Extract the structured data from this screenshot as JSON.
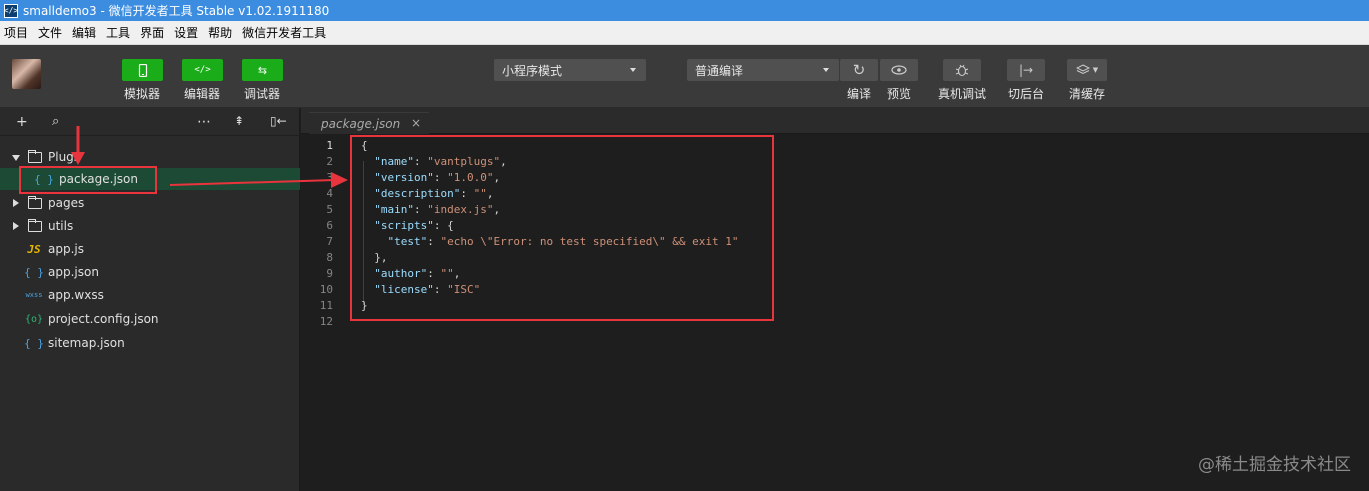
{
  "window": {
    "title": "smalldemo3 - 微信开发者工具 Stable v1.02.1911180",
    "app_icon": "</>"
  },
  "menu": [
    "项目",
    "文件",
    "编辑",
    "工具",
    "界面",
    "设置",
    "帮助",
    "微信开发者工具"
  ],
  "toolbar": {
    "simulator_label": "模拟器",
    "editor_label": "编辑器",
    "debugger_label": "调试器",
    "mode_select": "小程序模式",
    "compile_select": "普通编译",
    "compile_label": "编译",
    "preview_label": "预览",
    "device_debug_label": "真机调试",
    "background_label": "切后台",
    "clear_cache_label": "清缓存",
    "icons": {
      "simulator": "phone-icon",
      "editor": "code-icon",
      "debugger": "swap-icon",
      "compile": "refresh-icon",
      "preview": "eye-icon",
      "device_debug": "bug-icon",
      "background": "exit-icon",
      "clear_cache": "layers-icon"
    }
  },
  "sidebar": {
    "tree": [
      {
        "label": "Plugs",
        "type": "folder",
        "expanded": true
      },
      {
        "label": "package.json",
        "type": "json",
        "icon": "{ }"
      },
      {
        "label": "pages",
        "type": "folder",
        "expanded": false
      },
      {
        "label": "utils",
        "type": "folder",
        "expanded": false
      },
      {
        "label": "app.js",
        "type": "js",
        "icon": "JS"
      },
      {
        "label": "app.json",
        "type": "json",
        "icon": "{ }"
      },
      {
        "label": "app.wxss",
        "type": "wxss",
        "icon": "wxss"
      },
      {
        "label": "project.config.json",
        "type": "config",
        "icon": "{o}"
      },
      {
        "label": "sitemap.json",
        "type": "json",
        "icon": "{ }"
      }
    ]
  },
  "editor": {
    "tab_label": "package.json",
    "line_numbers": [
      "1",
      "2",
      "3",
      "4",
      "5",
      "6",
      "7",
      "8",
      "9",
      "10",
      "11",
      "12"
    ],
    "code": {
      "l1": "{",
      "name_key": "\"name\"",
      "name_val": "\"vantplugs\"",
      "version_key": "\"version\"",
      "version_val": "\"1.0.0\"",
      "description_key": "\"description\"",
      "description_val": "\"\"",
      "main_key": "\"main\"",
      "main_val": "\"index.js\"",
      "scripts_key": "\"scripts\"",
      "test_key": "\"test\"",
      "test_val": "\"echo \\\"Error: no test specified\\\" && exit 1\"",
      "l9": "},",
      "author_key": "\"author\"",
      "author_val": "\"\"",
      "license_key": "\"license\"",
      "license_val": "\"ISC\"",
      "l12": "}"
    }
  },
  "watermark": "@稀土掘金技术社区",
  "colors": {
    "accent_green": "#1aad19",
    "annotation_red": "#e8343c",
    "titlebar_blue": "#3c8de0"
  }
}
